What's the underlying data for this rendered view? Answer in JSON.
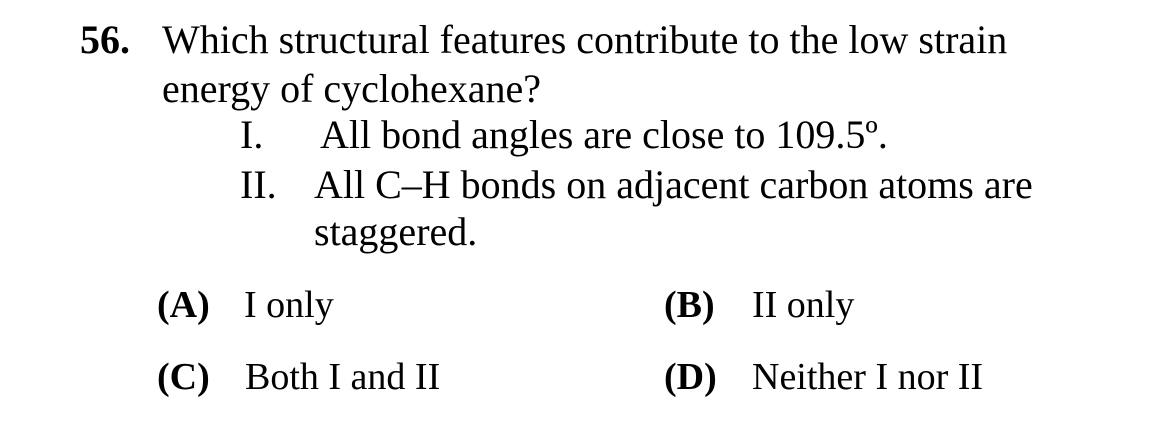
{
  "question": {
    "number": "56.",
    "stem_line1": "Which structural features contribute to the low strain",
    "stem_line2": "energy of cyclohexane?"
  },
  "statements": [
    {
      "numeral": "I.",
      "text": "All bond angles are close to 109.5º."
    },
    {
      "numeral": "II.",
      "text_line1": "All C–H bonds on adjacent carbon atoms are",
      "text_line2": "staggered."
    }
  ],
  "choices": [
    {
      "label": "(A)",
      "text": "I only"
    },
    {
      "label": "(B)",
      "text": "II only"
    },
    {
      "label": "(C)",
      "text": "Both I and II"
    },
    {
      "label": "(D)",
      "text": "Neither I nor II"
    }
  ]
}
